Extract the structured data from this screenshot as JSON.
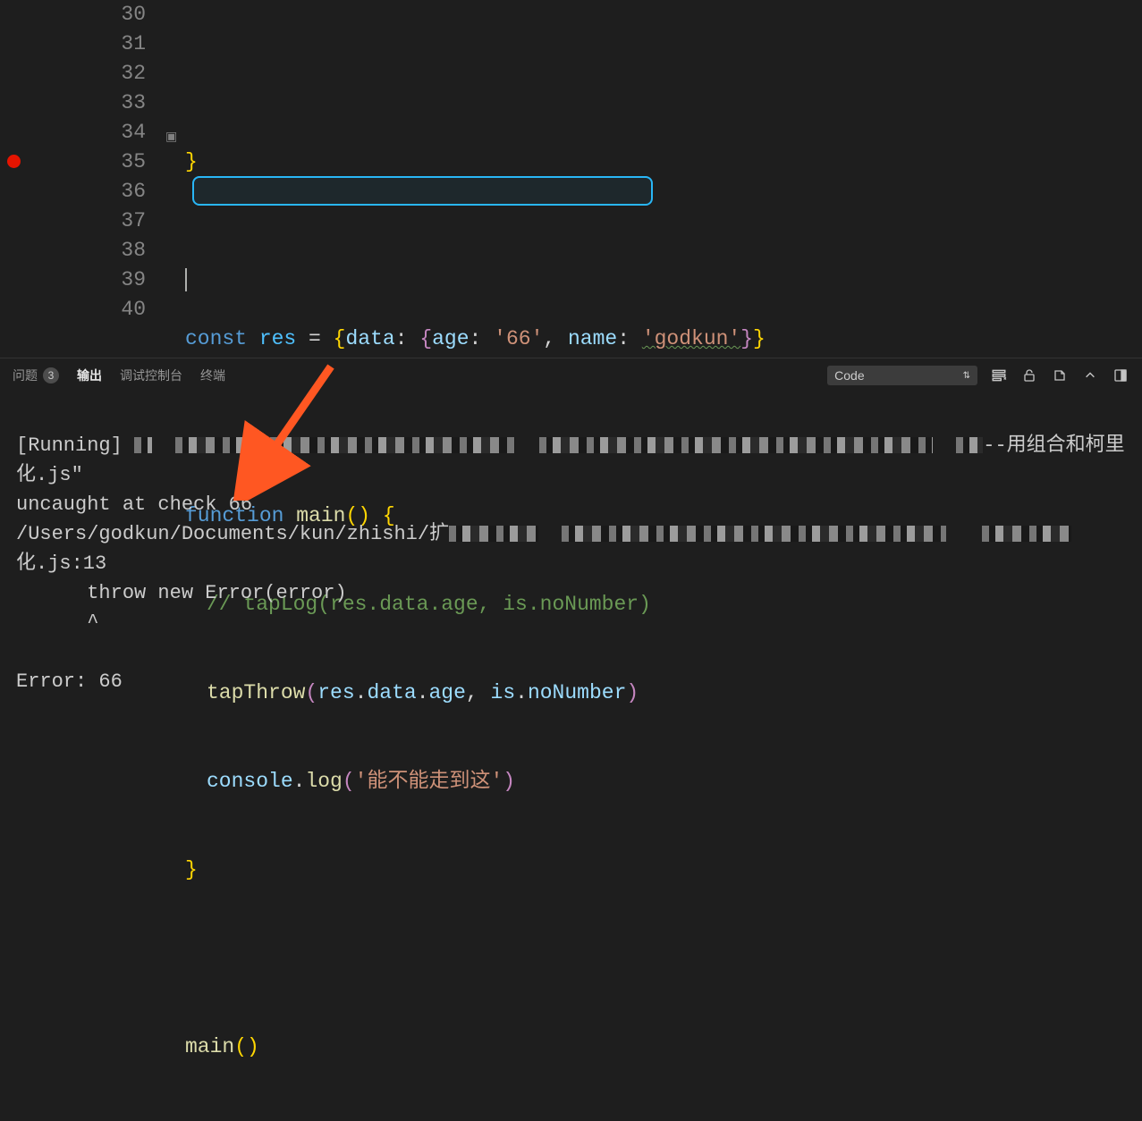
{
  "lines": [
    {
      "n": 30
    },
    {
      "n": 31
    },
    {
      "n": 32
    },
    {
      "n": 33
    },
    {
      "n": 34
    },
    {
      "n": 35
    },
    {
      "n": 36
    },
    {
      "n": 37
    },
    {
      "n": 38
    },
    {
      "n": 39
    },
    {
      "n": 40
    }
  ],
  "code": {
    "l30_brace": "}",
    "l32_const": "const",
    "l32_res": "res",
    "l32_eq": " = ",
    "l32_ob1": "{",
    "l32_data": "data",
    "l32_colon1": ": ",
    "l32_ob2": "{",
    "l32_age": "age",
    "l32_colon2": ": ",
    "l32_ageval": "'66'",
    "l32_comma": ", ",
    "l32_name": "name",
    "l32_colon3": ": ",
    "l32_nameval": "'godkun'",
    "l32_cb2": "}",
    "l32_cb1": "}",
    "l34_function": "function",
    "l34_main": "main",
    "l34_paren": "()",
    "l34_brace": " {",
    "l35_comment": "// tapLog(res.data.age, is.noNumber)",
    "l36_tapThrow": "tapThrow",
    "l36_op": "(",
    "l36_res": "res",
    "l36_d1": ".",
    "l36_data": "data",
    "l36_d2": ".",
    "l36_age": "age",
    "l36_comma": ", ",
    "l36_is": "is",
    "l36_d3": ".",
    "l36_noNumber": "noNumber",
    "l36_cp": ")",
    "l37_console": "console",
    "l37_dot": ".",
    "l37_log": "log",
    "l37_op": "(",
    "l37_str": "'能不能走到这'",
    "l37_cp": ")",
    "l38_brace": "}",
    "l40_main": "main",
    "l40_paren": "()"
  },
  "panel": {
    "tabs": {
      "problems": "问题",
      "problems_count": "3",
      "output": "输出",
      "debug": "调试控制台",
      "terminal": "终端"
    },
    "selector": "Code"
  },
  "terminal": {
    "running": "[Running] ",
    "running_suffix": "--用组合和柯里化.js\"",
    "uncaught": "uncaught at check 66",
    "path_prefix": "/Users/godkun/Documents/kun/zhishi/扩",
    "path_suffix": "化.js:13",
    "throw_line": "      throw new Error(error)",
    "caret_line": "      ^",
    "error_line": "Error: 66"
  }
}
